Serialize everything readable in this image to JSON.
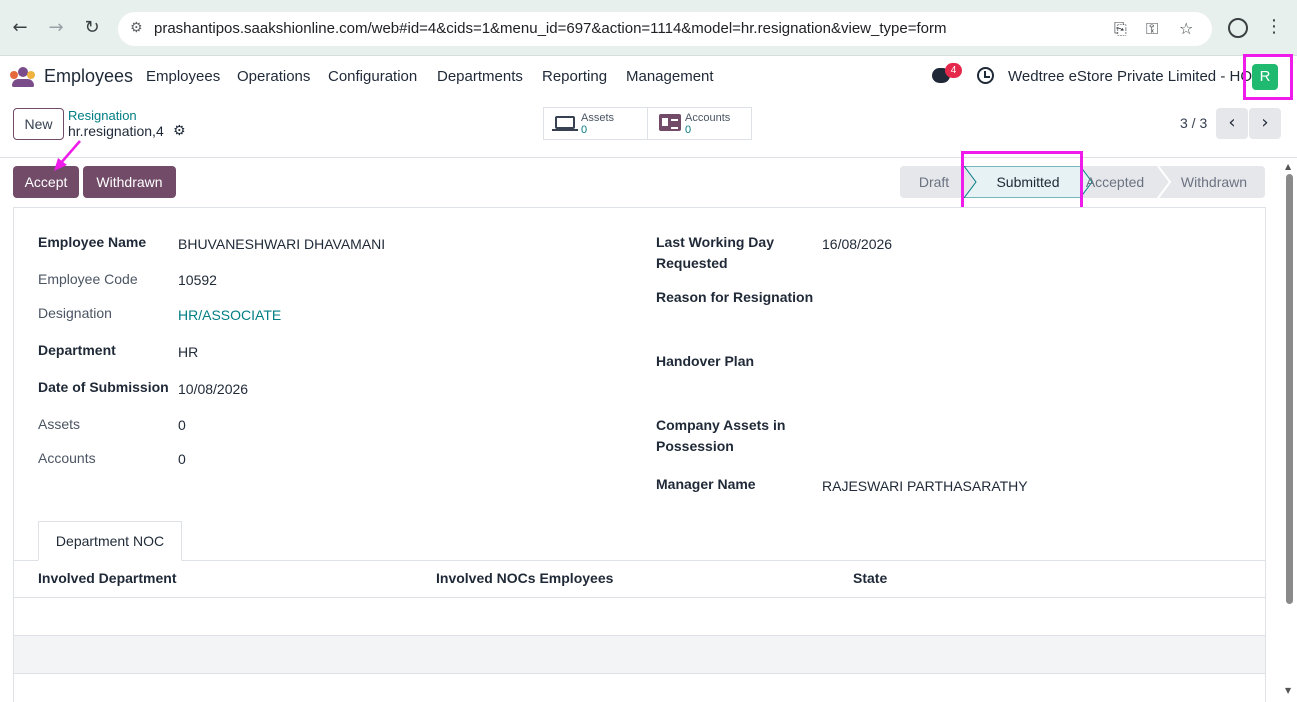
{
  "browser": {
    "url": "prashantipos.saakshionline.com/web#id=4&cids=1&menu_id=697&action=1114&model=hr.resignation&view_type=form",
    "back_glyph": "←",
    "forward_glyph": "→",
    "reload_glyph": "↻",
    "menu_glyph": "⋮"
  },
  "app": {
    "name": "Employees",
    "menu": [
      "Employees",
      "Operations",
      "Configuration",
      "Departments",
      "Reporting",
      "Management"
    ],
    "chat_count": "4",
    "company": "Wedtree eStore Private Limited - HO",
    "avatar_letter": "R",
    "colors": {
      "brand": "#714b67",
      "link": "#017e84",
      "avatar": "#1fba6f",
      "badge": "#e5294c",
      "highlight": "#ee1bea"
    }
  },
  "control": {
    "new_label": "New",
    "breadcrumb_parent": "Resignation",
    "breadcrumb_current": "hr.resignation,4",
    "smart_buttons": [
      {
        "label": "Assets",
        "value": "0",
        "icon": "laptop-icon"
      },
      {
        "label": "Accounts",
        "value": "0",
        "icon": "id-card-icon"
      }
    ],
    "pager": "3 / 3",
    "prev_glyph": "‹",
    "next_glyph": "›"
  },
  "actions": {
    "accept_label": "Accept",
    "withdrawn_label": "Withdrawn"
  },
  "statusbar": {
    "stages": [
      "Draft",
      "Submitted",
      "Accepted",
      "Withdrawn"
    ],
    "active": "Submitted"
  },
  "form": {
    "left": [
      {
        "label": "Employee Name",
        "value": "BHUVANESHWARI DHAVAMANI"
      },
      {
        "label": "Employee Code",
        "value": "10592"
      },
      {
        "label": "Designation",
        "value": "HR/ASSOCIATE"
      },
      {
        "label": "Department",
        "value": "HR"
      },
      {
        "label": "Date of Submission",
        "value": "10/08/2026"
      },
      {
        "label": "Assets",
        "value": "0"
      },
      {
        "label": "Accounts",
        "value": "0"
      }
    ],
    "right": [
      {
        "label_line1": "Last Working Day",
        "label_line2": "Requested",
        "value": "16/08/2026"
      },
      {
        "label": "Reason for Resignation",
        "value": ""
      },
      {
        "label": "Handover Plan",
        "value": ""
      },
      {
        "label_line1": "Company Assets in",
        "label_line2": "Possession",
        "value": ""
      },
      {
        "label": "Manager Name",
        "value": "RAJESWARI PARTHASARATHY"
      }
    ]
  },
  "notebook": {
    "tab": "Department NOC",
    "columns": [
      "Involved Department",
      "Involved NOCs Employees",
      "State"
    ]
  }
}
